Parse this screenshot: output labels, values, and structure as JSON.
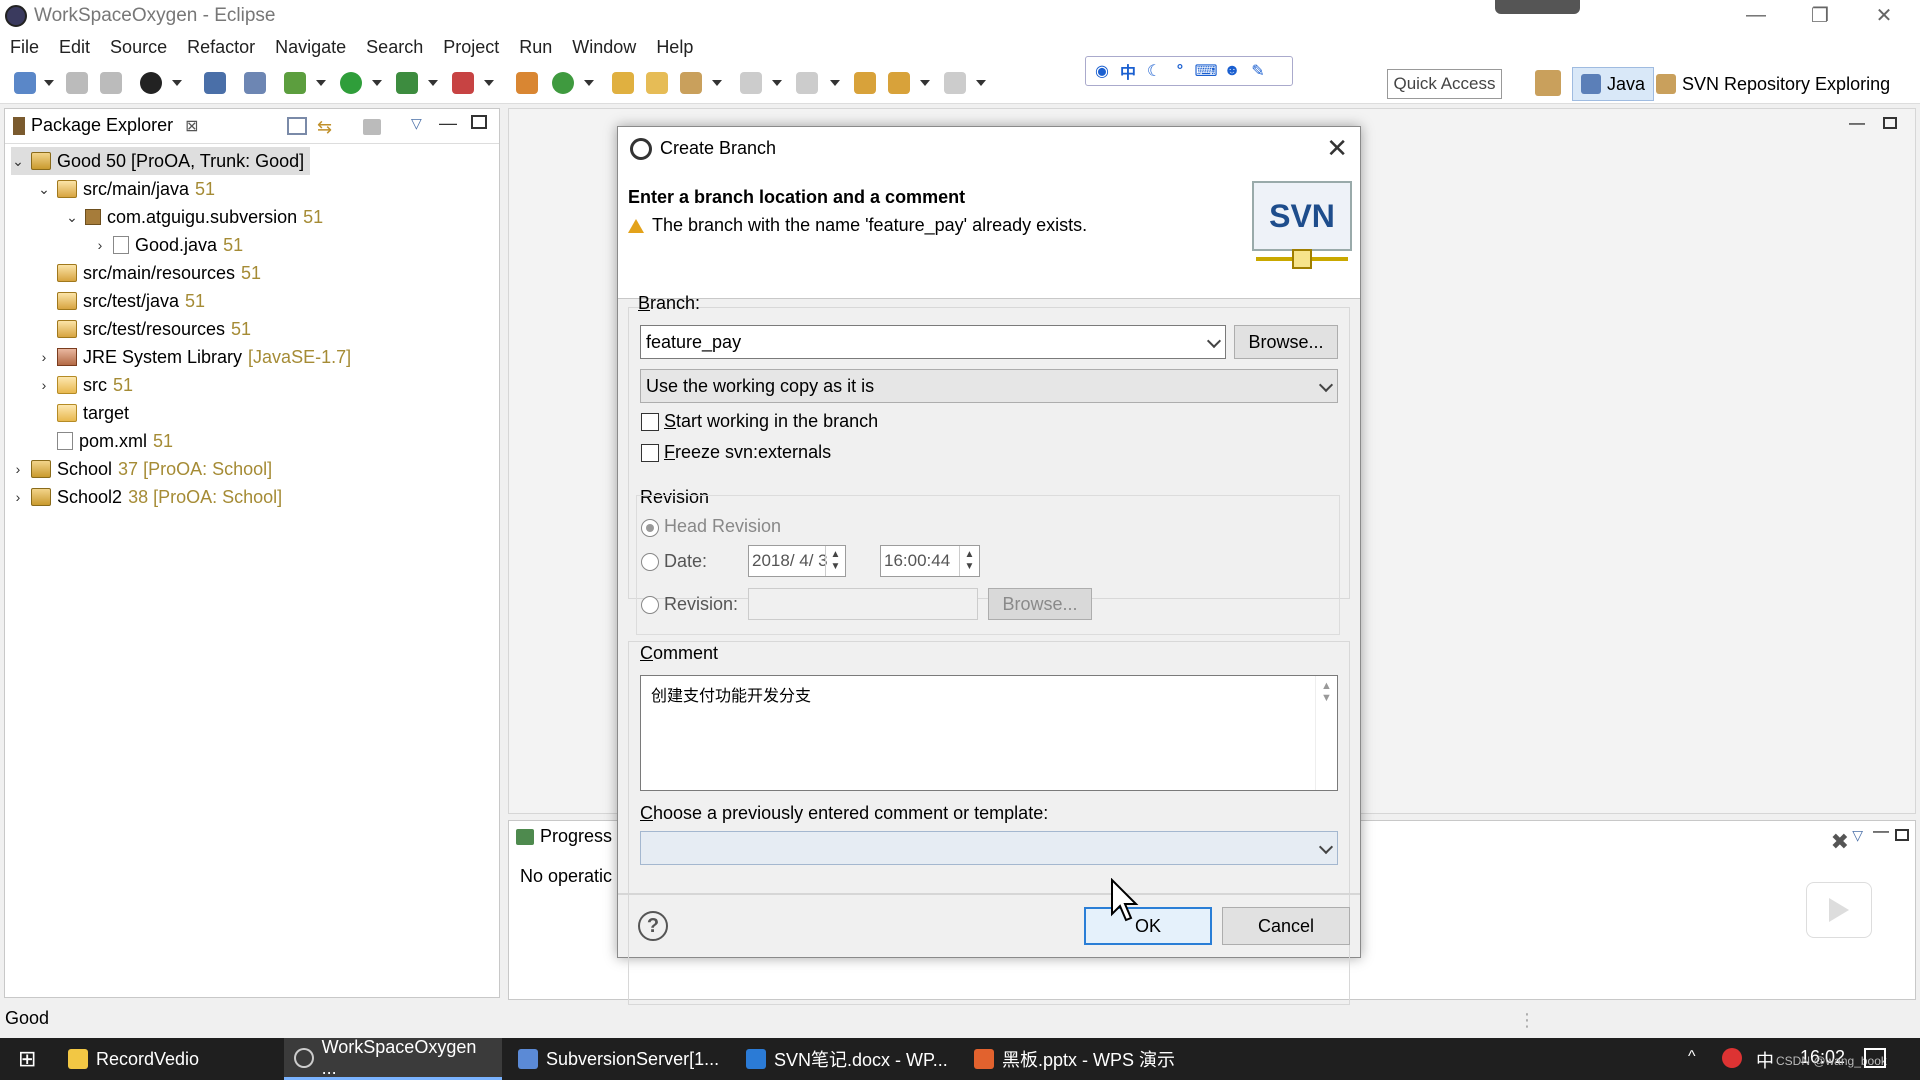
{
  "window": {
    "title": "WorkSpaceOxygen - Eclipse"
  },
  "menu": [
    "File",
    "Edit",
    "Source",
    "Refactor",
    "Navigate",
    "Search",
    "Project",
    "Run",
    "Window",
    "Help"
  ],
  "toolbar": {
    "quick_access": "Quick Access",
    "perspective_java": "Java",
    "perspective_svn": "SVN Repository Exploring"
  },
  "package_explorer": {
    "title": "Package Explorer",
    "tree": [
      {
        "label": "Good 50 [ProOA, Trunk: Good]",
        "ann": "",
        "twisty": "v",
        "icon": "project-icon"
      },
      {
        "label": "src/main/java",
        "ann": "51",
        "twisty": "v",
        "icon": "package-folder-icon"
      },
      {
        "label": "com.atguigu.subversion",
        "ann": "51",
        "twisty": "v",
        "icon": "package-icon"
      },
      {
        "label": "Good.java",
        "ann": "51",
        "twisty": ">",
        "icon": "java-file-icon"
      },
      {
        "label": "src/main/resources",
        "ann": "51",
        "twisty": "",
        "icon": "package-folder-icon"
      },
      {
        "label": "src/test/java",
        "ann": "51",
        "twisty": "",
        "icon": "package-folder-icon"
      },
      {
        "label": "src/test/resources",
        "ann": "51",
        "twisty": "",
        "icon": "package-folder-icon"
      },
      {
        "label": "JRE System Library",
        "ann": "[JavaSE-1.7]",
        "twisty": ">",
        "icon": "library-icon"
      },
      {
        "label": "src",
        "ann": "51",
        "twisty": ">",
        "icon": "folder-icon"
      },
      {
        "label": "target",
        "ann": "",
        "twisty": "",
        "icon": "folder-icon"
      },
      {
        "label": "pom.xml",
        "ann": "51",
        "twisty": "",
        "icon": "xml-file-icon"
      },
      {
        "label": "School",
        "ann": "37 [ProOA: School]",
        "twisty": ">",
        "icon": "project-icon"
      },
      {
        "label": "School2",
        "ann": "38 [ProOA: School]",
        "twisty": ">",
        "icon": "project-icon"
      }
    ]
  },
  "progress": {
    "tab": "Progress",
    "text": "No operatic"
  },
  "status": {
    "text": "Good"
  },
  "dialog": {
    "title": "Create Branch",
    "heading": "Enter a branch location and a comment",
    "warning": "The branch with the name 'feature_pay' already exists.",
    "logo": "SVN",
    "branch_label_u": "B",
    "branch_label_rest": "ranch:",
    "branch_value": "feature_pay",
    "browse": "Browse...",
    "mode_value": "Use the working copy as it is",
    "start_working_u": "S",
    "start_working_rest": "tart working in the branch",
    "freeze_u": "F",
    "freeze_rest": "reeze svn:externals",
    "revision_group": "Revision",
    "head_revision": "Head Revision",
    "date_label": "Date:",
    "date_value": "2018/  4/  3",
    "time_value": "16:00:44",
    "revision_label": "Revision:",
    "revision_browse": "Browse...",
    "comment_label_u": "C",
    "comment_label_rest": "omment",
    "comment_value": "创建支付功能开发分支",
    "choose_label_u": "C",
    "choose_label_rest": "hoose a previously entered comment or template:",
    "ok": "OK",
    "cancel": "Cancel"
  },
  "taskbar": {
    "items": [
      "RecordVedio",
      "WorkSpaceOxygen ...",
      "SubversionServer[1...",
      "SVN笔记.docx - WP...",
      "黑板.pptx - WPS 演示"
    ],
    "tray_lang": "中",
    "clock": "16:02",
    "watermark": "CSDN @wang_book"
  }
}
